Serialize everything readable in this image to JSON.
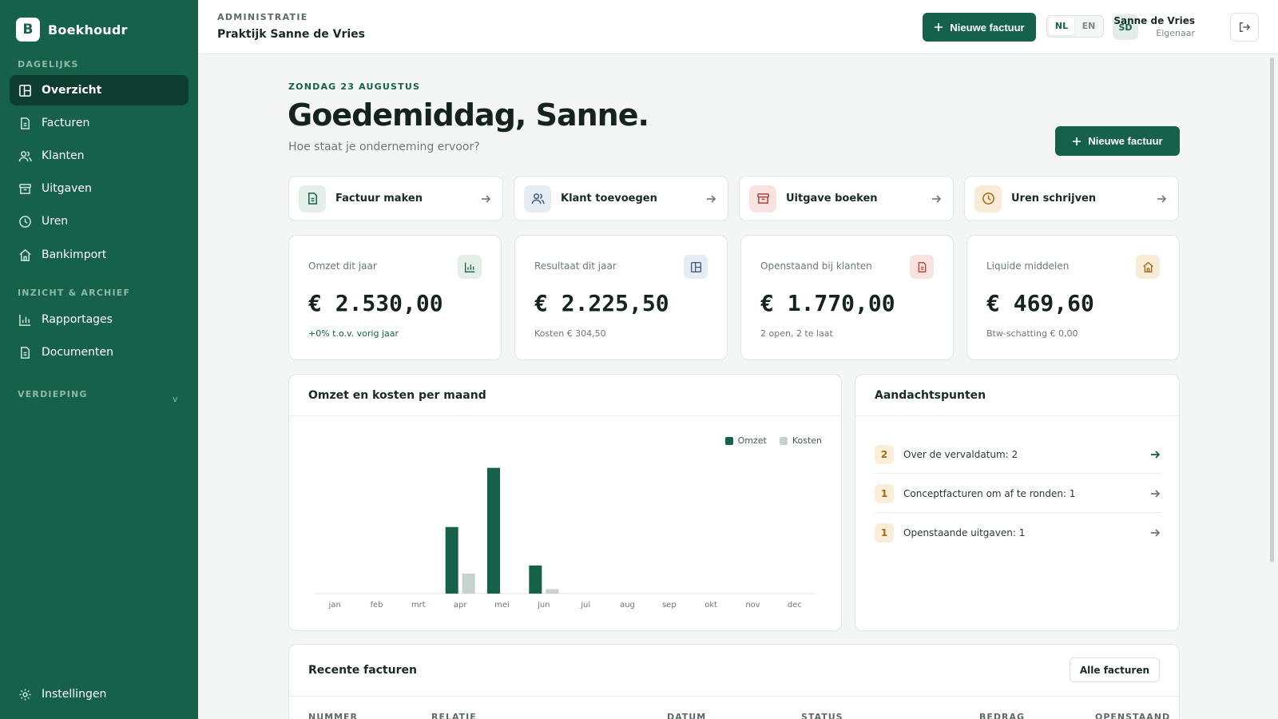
{
  "brand": {
    "initial": "B",
    "name": "Boekhoudr"
  },
  "sidebar": {
    "section_daily": "DAGELIJKS",
    "section_archive": "INZICHT & ARCHIEF",
    "section_deep": "VERDIEPING",
    "items": [
      {
        "label": "Overzicht",
        "icon": "dashboard-icon"
      },
      {
        "label": "Facturen",
        "icon": "document-icon"
      },
      {
        "label": "Klanten",
        "icon": "users-icon"
      },
      {
        "label": "Uitgaven",
        "icon": "archive-icon"
      },
      {
        "label": "Uren",
        "icon": "clock-icon"
      },
      {
        "label": "Bankimport",
        "icon": "bank-icon"
      },
      {
        "label": "Rapportages",
        "icon": "bar-chart-icon"
      },
      {
        "label": "Documenten",
        "icon": "document-icon"
      }
    ],
    "expand_glyph": "v",
    "settings": "Instellingen"
  },
  "header": {
    "subtitle": "ADMINISTRATIE",
    "title": "Praktijk Sanne de Vries",
    "new_invoice": "Nieuwe factuur",
    "lang_nl": "NL",
    "lang_en": "EN",
    "avatar": "SD",
    "user_name": "Sanne de Vries",
    "user_role": "Eigenaar"
  },
  "main": {
    "date": "ZONDAG 23 AUGUSTUS",
    "greeting": "Goedemiddag, Sanne.",
    "subtitle": "Hoe staat je onderneming ervoor?",
    "new_invoice": "Nieuwe factuur"
  },
  "quick_actions": [
    {
      "label": "Factuur maken"
    },
    {
      "label": "Klant toevoegen"
    },
    {
      "label": "Uitgave boeken"
    },
    {
      "label": "Uren schrijven"
    }
  ],
  "kpis": [
    {
      "label": "Omzet dit jaar",
      "value": "€ 2.530,00",
      "note": "+0% t.o.v. vorig jaar"
    },
    {
      "label": "Resultaat dit jaar",
      "value": "€ 2.225,50",
      "note": "Kosten € 304,50"
    },
    {
      "label": "Openstaand bij klanten",
      "value": "€ 1.770,00",
      "note": "2 open, 2 te laat"
    },
    {
      "label": "Liquide middelen",
      "value": "€ 469,60",
      "note": "Btw-schatting € 0,00"
    }
  ],
  "colors": {
    "brand": "#15614a",
    "omzet": "#15614a",
    "kosten": "#c7d1cd"
  },
  "chart_panel": {
    "title": "Omzet en kosten per maand"
  },
  "chart_data": {
    "type": "bar",
    "title": "Omzet en kosten per maand",
    "categories": [
      "jan",
      "feb",
      "mrt",
      "apr",
      "mei",
      "jun",
      "jul",
      "aug",
      "sep",
      "okt",
      "nov",
      "dec"
    ],
    "series": [
      {
        "name": "Omzet",
        "values": [
          0,
          0,
          0,
          900,
          1700,
          380,
          0,
          0,
          0,
          0,
          0,
          0
        ]
      },
      {
        "name": "Kosten",
        "values": [
          0,
          0,
          0,
          270,
          0,
          60,
          0,
          0,
          0,
          0,
          0,
          0
        ]
      }
    ],
    "ylim": [
      0,
      1750
    ],
    "grid": false,
    "legend": "top-right"
  },
  "attention": {
    "title": "Aandachtspunten",
    "items": [
      {
        "count": "2",
        "text": "Over de vervaldatum: 2"
      },
      {
        "count": "1",
        "text": "Conceptfacturen om af te ronden: 1"
      },
      {
        "count": "1",
        "text": "Openstaande uitgaven: 1"
      }
    ]
  },
  "recent": {
    "title": "Recente facturen",
    "all_button": "Alle facturen",
    "columns": [
      "NUMMER",
      "RELATIE",
      "DATUM",
      "STATUS",
      "BEDRAG",
      "OPENSTAAND"
    ]
  }
}
